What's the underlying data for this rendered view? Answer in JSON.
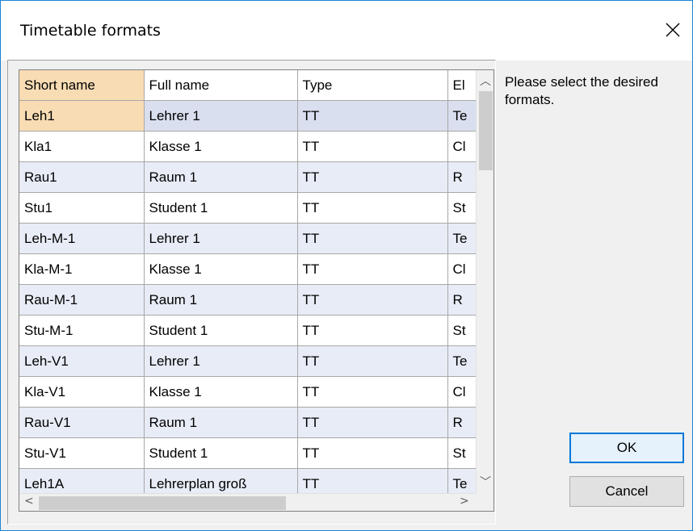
{
  "window": {
    "title": "Timetable formats"
  },
  "table": {
    "columns": [
      "Short name",
      "Full name",
      "Type",
      "El"
    ],
    "rows": [
      [
        "Leh1",
        "Lehrer 1",
        "TT",
        "Te"
      ],
      [
        "Kla1",
        "Klasse 1",
        "TT",
        "Cl"
      ],
      [
        "Rau1",
        "Raum 1",
        "TT",
        "R"
      ],
      [
        "Stu1",
        "Student 1",
        "TT",
        "St"
      ],
      [
        "Leh-M-1",
        "Lehrer 1",
        "TT",
        "Te"
      ],
      [
        "Kla-M-1",
        "Klasse 1",
        "TT",
        "Cl"
      ],
      [
        "Rau-M-1",
        "Raum 1",
        "TT",
        "R"
      ],
      [
        "Stu-M-1",
        "Student 1",
        "TT",
        "St"
      ],
      [
        "Leh-V1",
        "Lehrer 1",
        "TT",
        "Te"
      ],
      [
        "Kla-V1",
        "Klasse 1",
        "TT",
        "Cl"
      ],
      [
        "Rau-V1",
        "Raum 1",
        "TT",
        "R"
      ],
      [
        "Stu-V1",
        "Student 1",
        "TT",
        "St"
      ],
      [
        "Leh1A",
        "Lehrerplan groß",
        "TT",
        "Te"
      ]
    ]
  },
  "hint": "Please select the desired formats.",
  "buttons": {
    "ok": "OK",
    "cancel": "Cancel"
  },
  "icons": {
    "close": "close-icon",
    "scroll_up": "chevron-up-icon",
    "scroll_down": "chevron-down-icon",
    "scroll_left": "chevron-left-icon",
    "scroll_right": "chevron-right-icon"
  }
}
